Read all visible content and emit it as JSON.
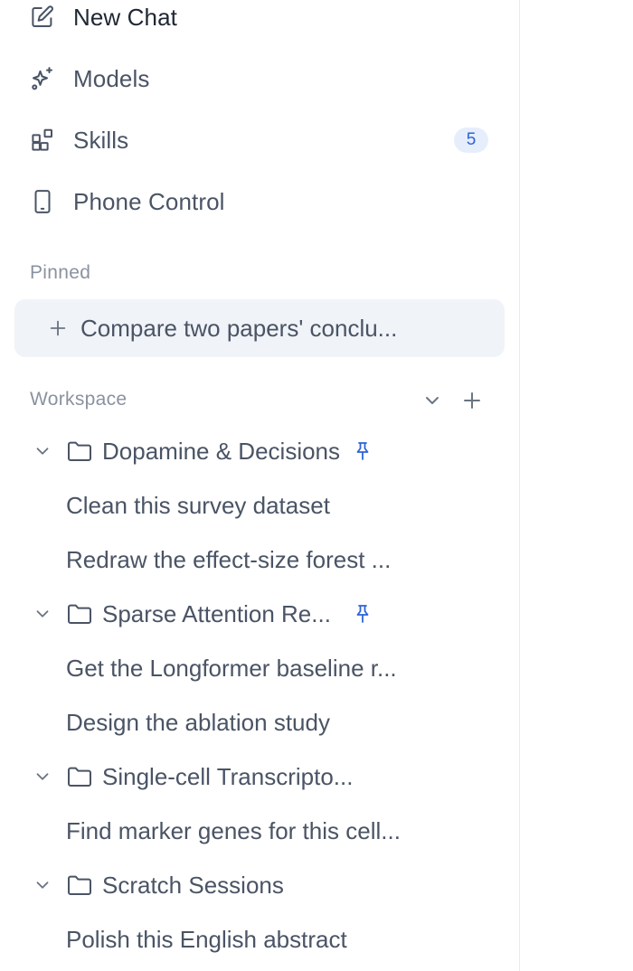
{
  "nav": {
    "new_chat": "New Chat",
    "models": "Models",
    "skills": "Skills",
    "skills_count": "5",
    "phone_control": "Phone Control"
  },
  "pinned": {
    "label": "Pinned",
    "items": [
      "Compare two papers' conclu..."
    ]
  },
  "workspace": {
    "label": "Workspace",
    "folders": [
      {
        "name": "Dopamine & Decisions",
        "pinned": true,
        "chats": [
          "Clean this survey dataset",
          "Redraw the effect-size forest ..."
        ]
      },
      {
        "name": "Sparse Attention Re...",
        "pinned": true,
        "chats": [
          "Get the Longformer baseline r...",
          "Design the ablation study"
        ]
      },
      {
        "name": "Single-cell Transcripto...",
        "pinned": false,
        "chats": [
          "Find marker genes for this cell..."
        ]
      },
      {
        "name": "Scratch Sessions",
        "pinned": false,
        "chats": [
          "Polish this English abstract"
        ]
      }
    ]
  },
  "colors": {
    "accent": "#2c63d8",
    "pin": "#2c63d8",
    "badge_bg": "#e6eefc",
    "pinned_bg": "#f0f3f7"
  }
}
